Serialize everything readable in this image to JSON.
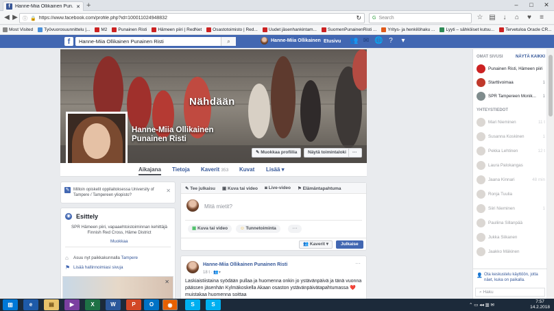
{
  "browser": {
    "tab_title": "Hanne-Miia Ollikainen Pun...",
    "url": "https://www.facebook.com/profile.php?id=100011024948832",
    "search_placeholder": "Search",
    "bookmarks": [
      "Most Visited",
      "Työvuorosuunnittelu |...",
      "M2",
      "Punainen Risti",
      "Hämeen piiri | RedNet",
      "Osastotoimisto | Red...",
      "Uudet jäsenhankintam...",
      "SuomenPunainenRisti ...",
      "Yritys- ja henkilöhaku ...",
      "Lyyti – sähköiset kutsu...",
      "Tervetuloa Oracle CR..."
    ]
  },
  "fb_header": {
    "search_value": "Hanne-Miia Ollikainen Punainen Risti",
    "user_name": "Hanne-Miia Ollikainen",
    "home_label": "Etusivu"
  },
  "cover": {
    "overlay_text": "Nähdään",
    "profile_name": "Hanne-Miia Ollikainen Punainen Risti",
    "edit_profile": "Muokkaa profiilia",
    "activity_log": "Näytä toimintaloki",
    "more": "···"
  },
  "profile_nav": {
    "timeline": "Aikajana",
    "about": "Tietoja",
    "friends": "Kaverit",
    "friends_count": "353",
    "photos": "Kuvat",
    "more": "Lisää ▾"
  },
  "edu_prompt": "Milloin opiskelit oppilaitoksessa University of Tampere / Tampereen yliopisto?",
  "intro": {
    "title": "Esittely",
    "bio": "SPR Hämeen piiri, vapaaehtoistoiminnan kehittäjä Finnish Red Cross, Häme District",
    "edit": "Muokkaa",
    "lives_prefix": "Asuu nyt paikkakunnalla ",
    "lives_city": "Tampere",
    "add_featured": "Lisää hallinnoimiasi sivuja"
  },
  "composer": {
    "tabs": [
      "Tee julkaisu",
      "Kuva tai video",
      "Live-video",
      "Elämäntapahtuma"
    ],
    "placeholder": "Mitä mietit?",
    "photo_video": "Kuva tai video",
    "feeling": "Tunnetoiminta",
    "audience": "Kaverit ▾",
    "publish": "Julkaise"
  },
  "post": {
    "author": "Hanne-Miia Ollikainen Punainen Risti",
    "time": "18 t",
    "text": "Laskiaistiistaina syödään pullaa ja huomenna onkin jo ystävänpäivä ja tänä vuonna päässen jäsenhän Kylmäkoskella Akaan osaston ystävänpäivätapahtumassa ❤️ muistakaa huomenna soittaa"
  },
  "sidebar": {
    "own_pages": "OMAT SIVUSI",
    "show_all": "NÄYTÄ KAIKKI",
    "pages": [
      {
        "name": "Punainen Risti, Hämeen piiri",
        "count": ""
      },
      {
        "name": "Starttivoimaa",
        "count": "1"
      },
      {
        "name": "SPR Tampereen Monik...",
        "count": "1"
      }
    ],
    "contacts_title": "YHTEYSTIEDOT",
    "contacts": [
      {
        "name": "Mari Nieminen",
        "count": "11 t"
      },
      {
        "name": "Susanna Koskinen",
        "count": "1"
      },
      {
        "name": "Pekka Lehtinen",
        "count": "12 t"
      },
      {
        "name": "Laura Palokangas",
        "count": ""
      },
      {
        "name": "Jaana Kinnari",
        "count": "48 min"
      },
      {
        "name": "Ronja Tuulia",
        "count": ""
      },
      {
        "name": "Siiri Nieminen",
        "count": "1"
      },
      {
        "name": "Pauliina Sillanpää",
        "count": ""
      },
      {
        "name": "Jukka Siikanen",
        "count": ""
      },
      {
        "name": "Jaakko Mäkinen",
        "count": ""
      }
    ],
    "chat_promo": "Ota keskustelu käyttöön, jotta näet, kuka on paikalla.",
    "search_placeholder": "Haku"
  },
  "taskbar": {
    "time": "7:57",
    "date": "14.2.2018"
  },
  "colors": {
    "fb_blue": "#4267b2",
    "link": "#365899",
    "publish": "#4267b2"
  }
}
